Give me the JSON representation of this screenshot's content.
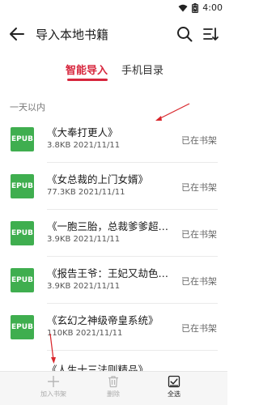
{
  "status_bar": {
    "time": "4:00"
  },
  "header": {
    "title": "导入本地书籍"
  },
  "tabs": [
    {
      "label": "智能导入",
      "active": true
    },
    {
      "label": "手机目录",
      "active": false
    }
  ],
  "section": {
    "label": "一天以内"
  },
  "books": [
    {
      "format": "EPUB",
      "title": "《大奉打更人》",
      "meta": "3.8KB 2021/11/11",
      "status": "已在书架"
    },
    {
      "format": "EPUB",
      "title": "《女总裁的上门女婿》",
      "meta": "77.3KB 2021/11/11",
      "status": "已在书架"
    },
    {
      "format": "EPUB",
      "title": "《一胞三胎，总裁爹爹超凶...",
      "meta": "3.9KB 2021/11/11",
      "status": "已在书架"
    },
    {
      "format": "EPUB",
      "title": "《报告王爷：王妃又劫色了》",
      "meta": "3.9KB 2021/11/11",
      "status": "已在书架"
    },
    {
      "format": "EPUB",
      "title": "《玄幻之神级帝皇系统》",
      "meta": "110KB 2021/11/11",
      "status": "已在书架"
    }
  ],
  "partial_book": {
    "title": "《人生十三法则精品》"
  },
  "bottom_bar": {
    "add_label": "加入书架",
    "delete_label": "删除",
    "select_all_label": "全选"
  },
  "colors": {
    "accent": "#d7263d",
    "epub_badge": "#3fae4f",
    "annotation_arrow": "#d9262c"
  }
}
